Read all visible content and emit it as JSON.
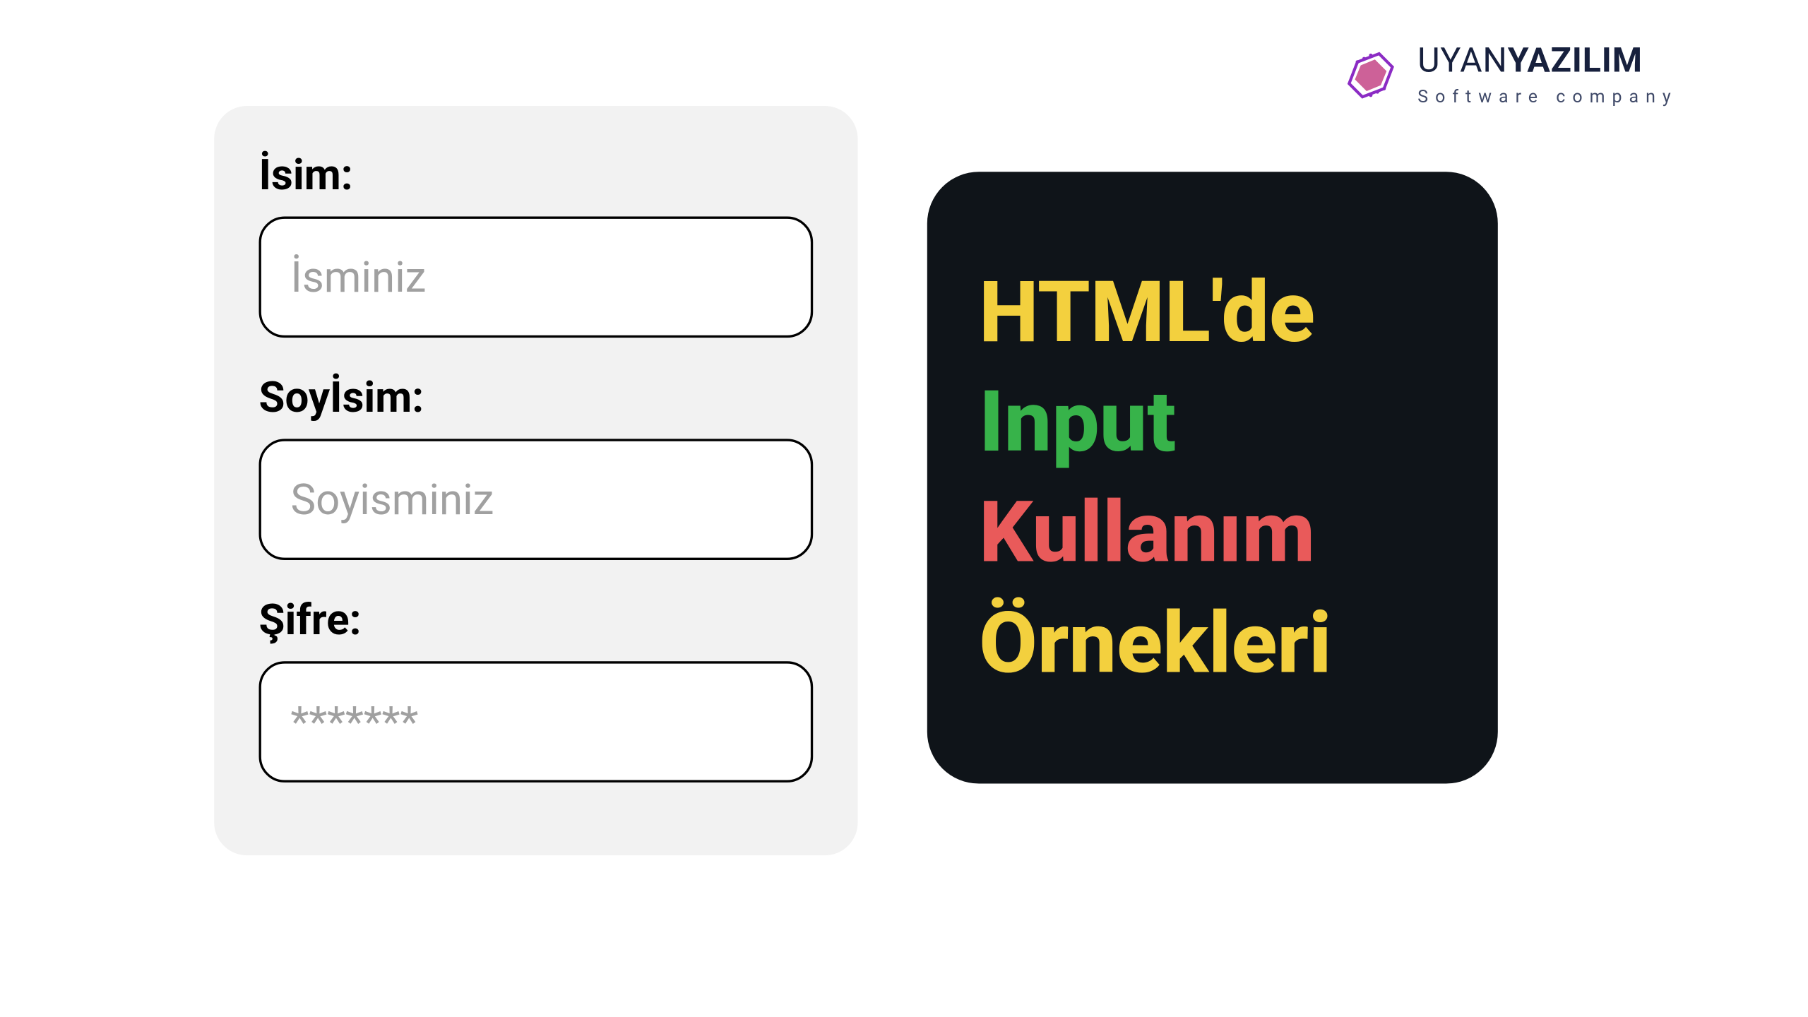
{
  "logo": {
    "brand_light": "UYAN",
    "brand_bold": "YAZILIM",
    "tagline": "Software company"
  },
  "form": {
    "name": {
      "label": "İsim:",
      "placeholder": "İsminiz",
      "value": ""
    },
    "surname": {
      "label": "Soyİsim:",
      "placeholder": "Soyisminiz",
      "value": ""
    },
    "password": {
      "label": "Şifre:",
      "placeholder": "*******",
      "value": ""
    }
  },
  "title": {
    "line1": "HTML'de",
    "line2": "Input",
    "line3": "Kullanım",
    "line4": "Örnekleri"
  }
}
